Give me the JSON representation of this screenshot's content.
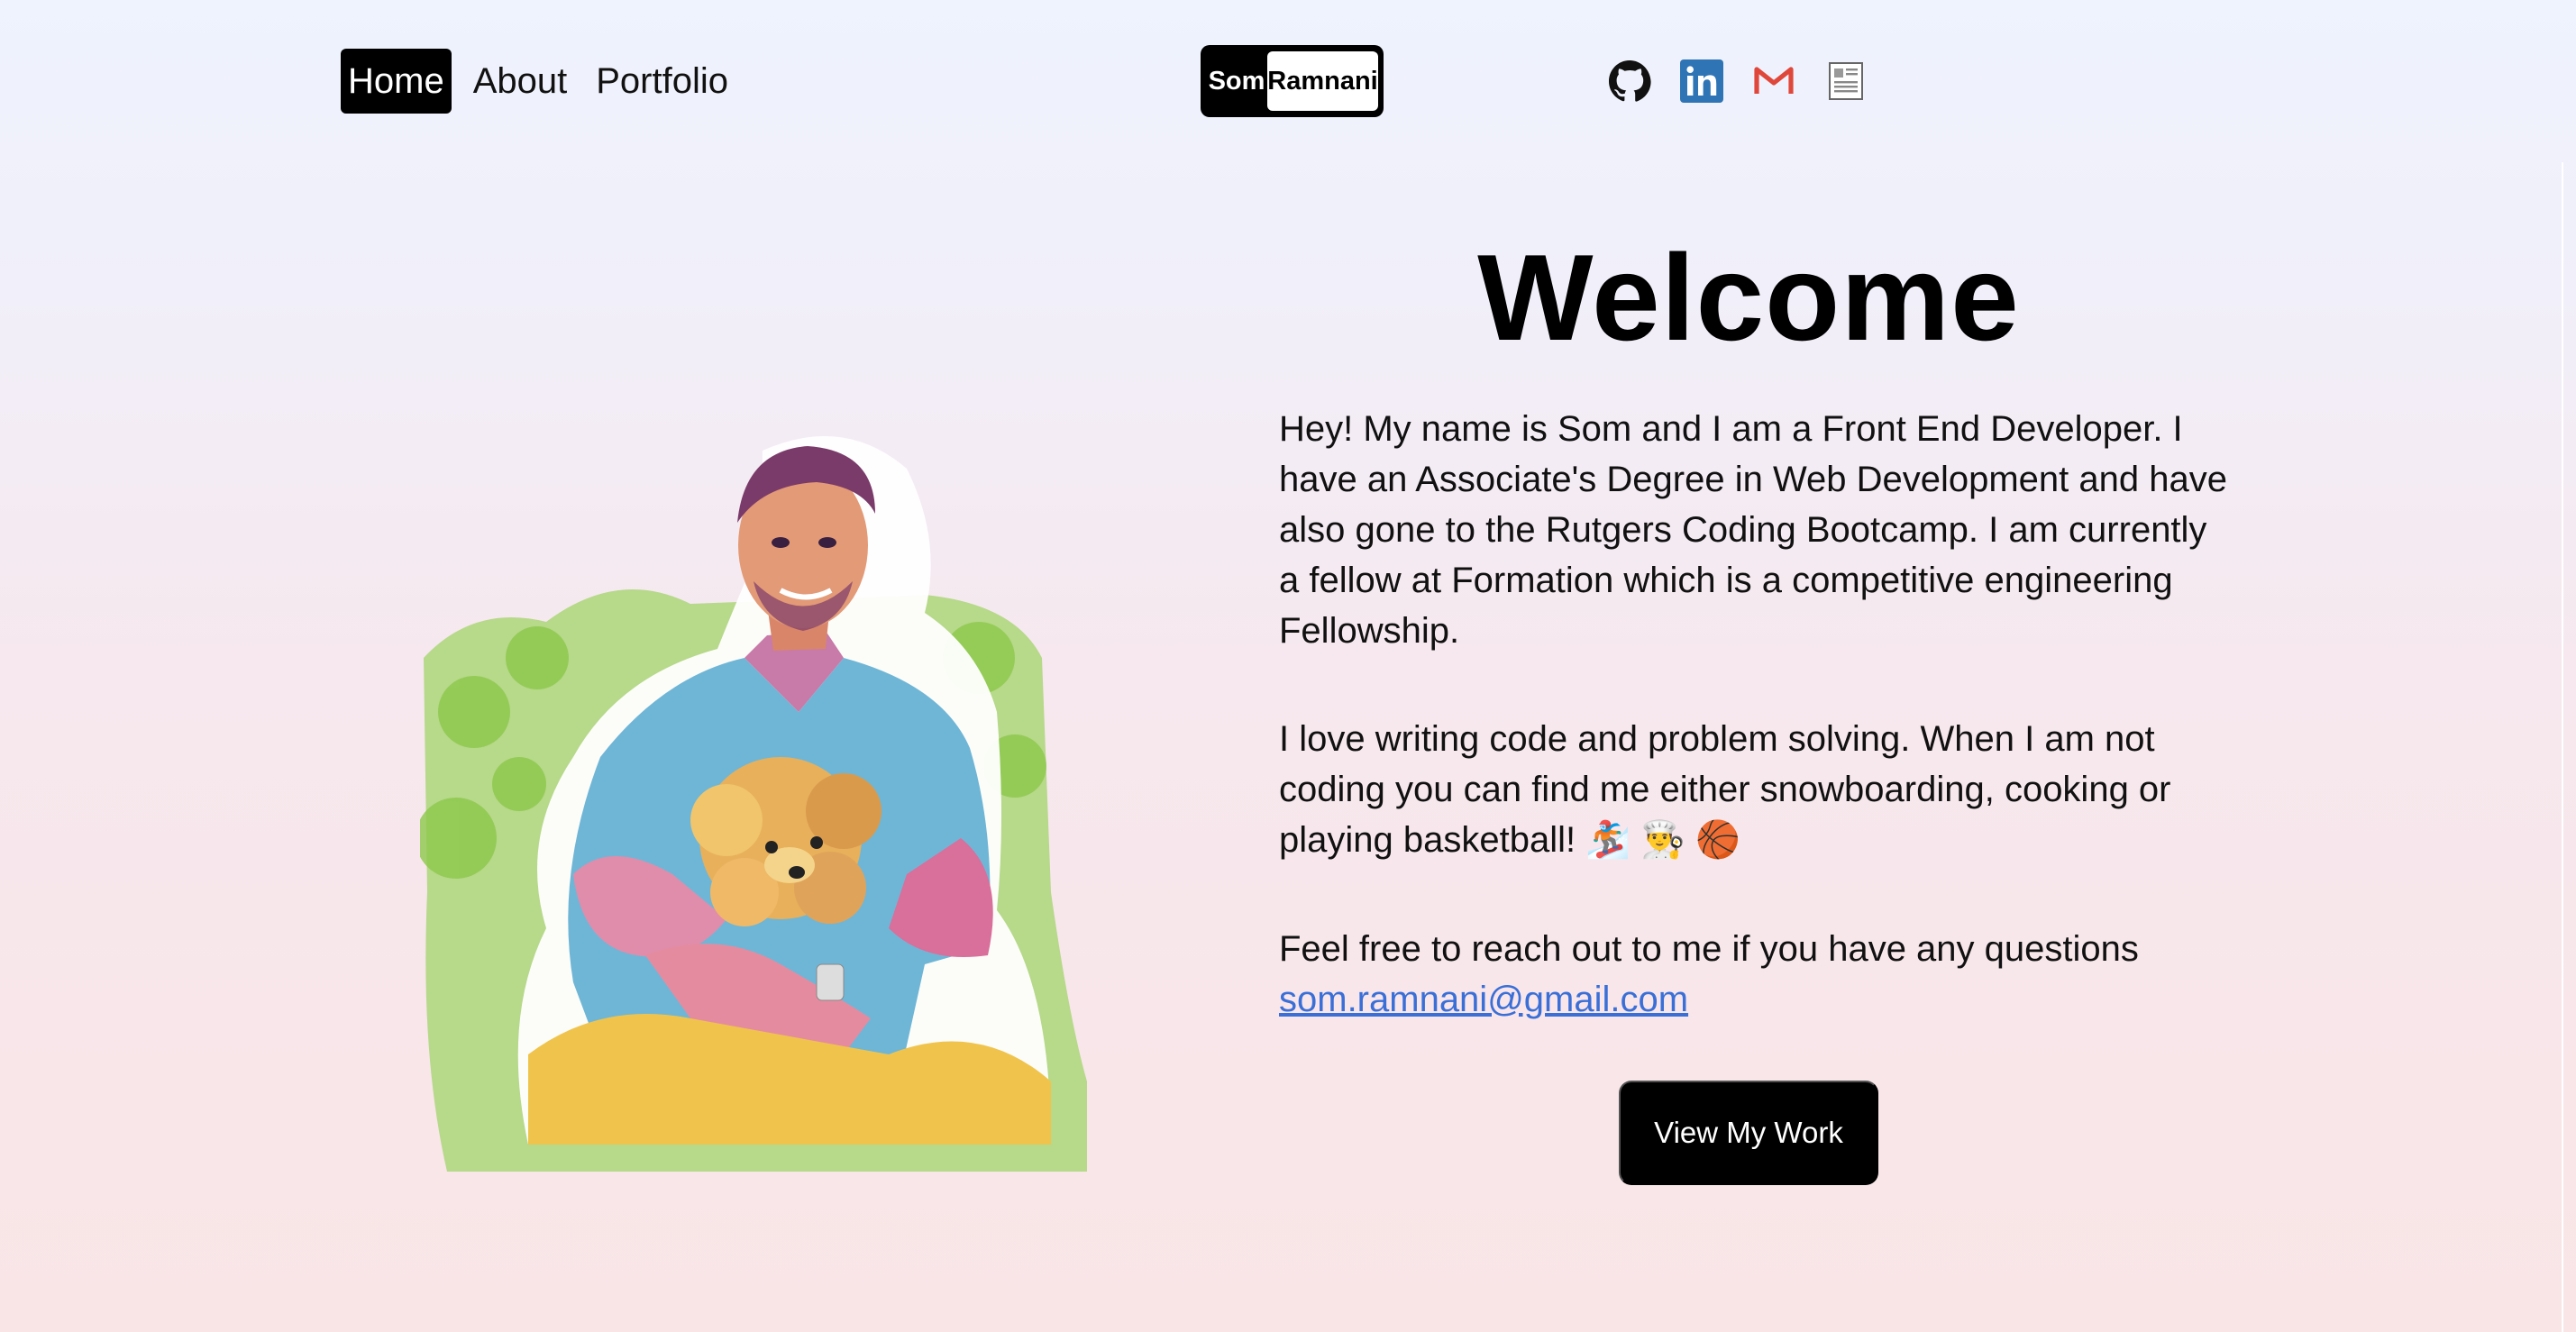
{
  "nav": {
    "items": [
      {
        "label": "Home",
        "active": true
      },
      {
        "label": "About",
        "active": false
      },
      {
        "label": "Portfolio",
        "active": false
      }
    ]
  },
  "logo": {
    "first": "Som",
    "last": "Ramnani"
  },
  "socials": [
    {
      "icon": "github-icon"
    },
    {
      "icon": "linkedin-icon",
      "color": "#2f74b5"
    },
    {
      "icon": "gmail-icon",
      "color": "#e0473b"
    },
    {
      "icon": "resume-icon"
    }
  ],
  "hero": {
    "title": "Welcome",
    "paragraph1": "Hey! My name is Som and I am a Front End Developer. I have an Associate's Degree in Web Development and have also gone to the Rutgers Coding Bootcamp. I am currently a fellow at Formation which is a competitive engineering Fellowship.",
    "paragraph2": "I love writing code and problem solving. When I am not coding you can find me either snowboarding, cooking or playing basketball! 🏂 👨‍🍳 🏀",
    "paragraph3": "Feel free to reach out to me if you have any questions",
    "email": "som.ramnani@gmail.com",
    "cta_label": "View My Work"
  },
  "colors": {
    "accent": "#000000",
    "link": "#3a6fd8"
  }
}
